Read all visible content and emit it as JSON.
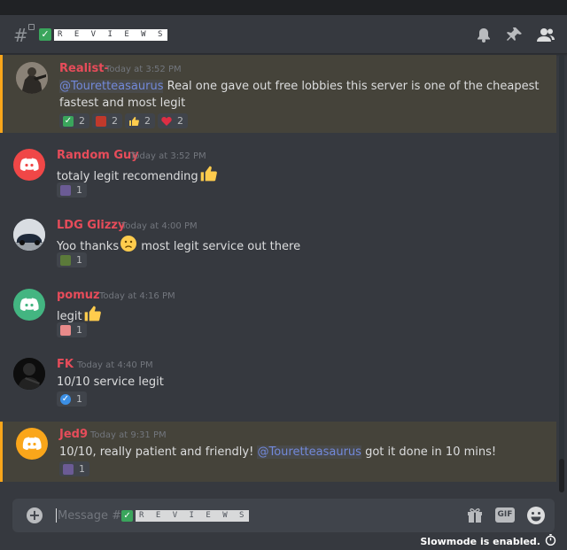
{
  "channel": {
    "name": "R E V I E W S",
    "check_glyph": "✓"
  },
  "header": {
    "icons": [
      "bell-icon",
      "pin-icon",
      "members-icon"
    ]
  },
  "messages": [
    {
      "username": "Realist-",
      "timestamp": "Today at 3:52 PM",
      "mention": "@Touretteasaurus",
      "text_after_mention": " Real one gave out free lobbies this server is one of the cheapest",
      "line2": "fastest and most legit",
      "highlighted": true,
      "reactions": [
        {
          "emoji": "white-check-mark",
          "count": "2"
        },
        {
          "emoji": "custom-emoji",
          "count": "2"
        },
        {
          "emoji": "thumbs-up",
          "count": "2"
        },
        {
          "emoji": "red-heart",
          "count": "2"
        }
      ]
    },
    {
      "username": "Random Guy",
      "timestamp": "Today at 3:52 PM",
      "text": "totaly legit recomending",
      "highlighted": false,
      "reactions": [
        {
          "emoji": "custom-emoji",
          "count": "1"
        }
      ]
    },
    {
      "username": "LDG Glizzy",
      "timestamp": "Today at 4:00 PM",
      "text_before": "Yoo thanks",
      "text_after": " most legit service out there",
      "highlighted": false,
      "reactions": [
        {
          "emoji": "custom-emoji",
          "count": "1"
        }
      ]
    },
    {
      "username": "pomuz",
      "timestamp": "Today at 4:16 PM",
      "text": "legit",
      "highlighted": false,
      "reactions": [
        {
          "emoji": "custom-emoji",
          "count": "1"
        }
      ]
    },
    {
      "username": "FK",
      "timestamp": "Today at 4:40 PM",
      "text": "10/10 service legit",
      "highlighted": false,
      "reactions": [
        {
          "emoji": "verified-check",
          "count": "1"
        }
      ]
    },
    {
      "username": "Jed9",
      "timestamp": "Today at 9:31 PM",
      "text_before": "10/10, really patient and friendly! ",
      "mention": "@Touretteasaurus",
      "text_after": " got it done in 10 mins!",
      "highlighted": true,
      "reactions": [
        {
          "emoji": "custom-emoji",
          "count": "1"
        }
      ]
    }
  ],
  "composer": {
    "placeholder_prefix": "Message #",
    "placeholder_channel": "R E V I E W S",
    "check_glyph": "✓",
    "gif_label": "GIF",
    "plus_glyph": "+"
  },
  "footer": {
    "slowmode_text": "Slowmode is enabled."
  },
  "colors": {
    "username": "#e74c5a",
    "mention": "#7289da",
    "highlight_bar": "#faa61a",
    "background": "#36393f"
  }
}
